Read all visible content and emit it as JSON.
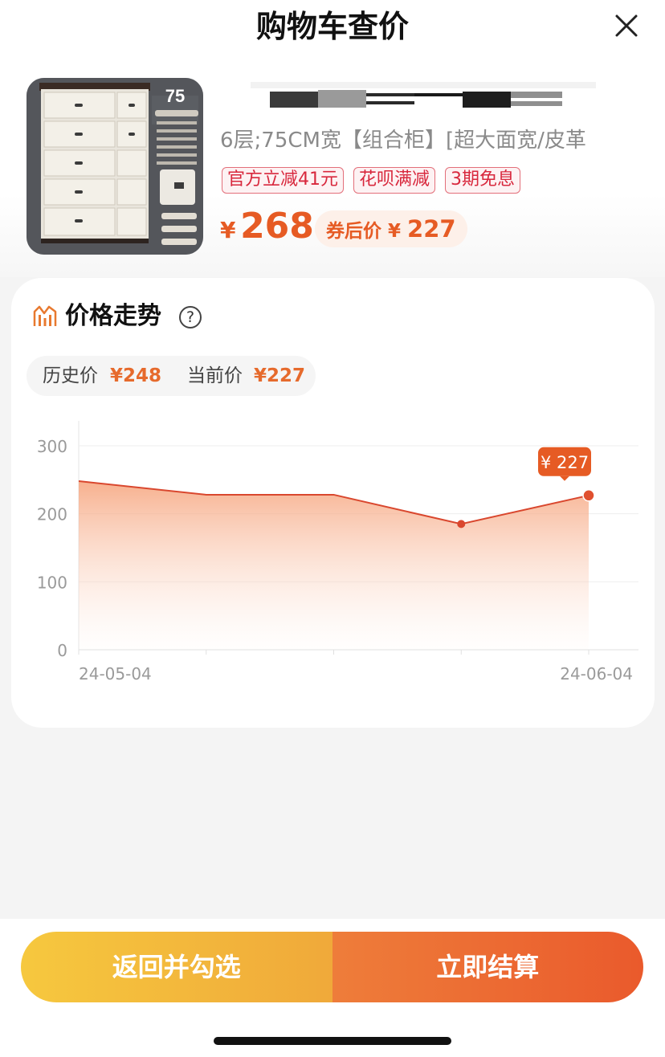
{
  "header": {
    "title": "购物车查价"
  },
  "product": {
    "thumb_badge": "75",
    "spec": "6层;75CM宽【组合柜】[超大面宽/皮革",
    "tags": [
      "官方立减41元",
      "花呗满减",
      "3期免息"
    ],
    "currency": "¥",
    "price": "268",
    "coupon_label": "券后价",
    "coupon_price": "227"
  },
  "trend": {
    "title": "价格走势",
    "help": "?",
    "history_label": "历史价",
    "history_value": "¥248",
    "current_label": "当前价",
    "current_value": "¥227"
  },
  "chart_data": {
    "type": "area",
    "x_labels": [
      "24-05-04",
      "24-06-04"
    ],
    "y_ticks": [
      0,
      100,
      200,
      300
    ],
    "ylim": [
      0,
      300
    ],
    "values": [
      248,
      228,
      228,
      185,
      227
    ],
    "highlight_label": "¥ 227",
    "grid": true
  },
  "actions": {
    "back_label": "返回并勾选",
    "pay_label": "立即结算"
  },
  "colors": {
    "accent": "#e65b24",
    "line": "#d9472e"
  }
}
